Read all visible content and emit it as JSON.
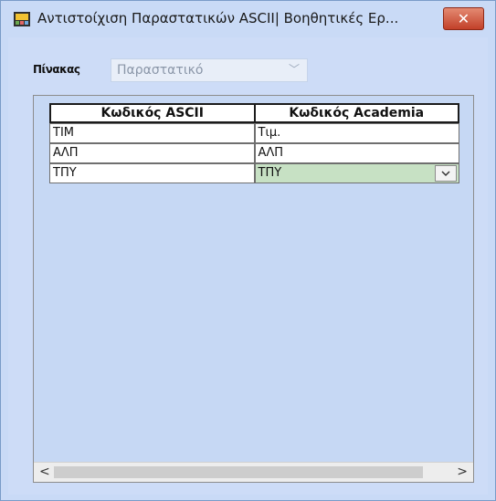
{
  "window": {
    "title": "Αντιστοίχιση Παραστατικών ASCII| Βοηθητικές Ερ...",
    "close_glyph": "✕"
  },
  "filter": {
    "label": "Πίνακας",
    "value": "Παραστατικό"
  },
  "grid": {
    "columns": [
      "Κωδικός ASCII",
      "Κωδικός Academia"
    ],
    "rows": [
      {
        "ascii": "ΤΙΜ",
        "academia": "Τιμ."
      },
      {
        "ascii": "ΑΛΠ",
        "academia": "ΑΛΠ"
      },
      {
        "ascii": "ΤΠΥ",
        "academia": "ΤΠΥ"
      }
    ]
  },
  "scrollbar": {
    "left_glyph": "<",
    "right_glyph": ">"
  },
  "colors": {
    "background": "#cddcf7",
    "selected_cell": "#c7e1c4",
    "close_button": "#c24029"
  }
}
